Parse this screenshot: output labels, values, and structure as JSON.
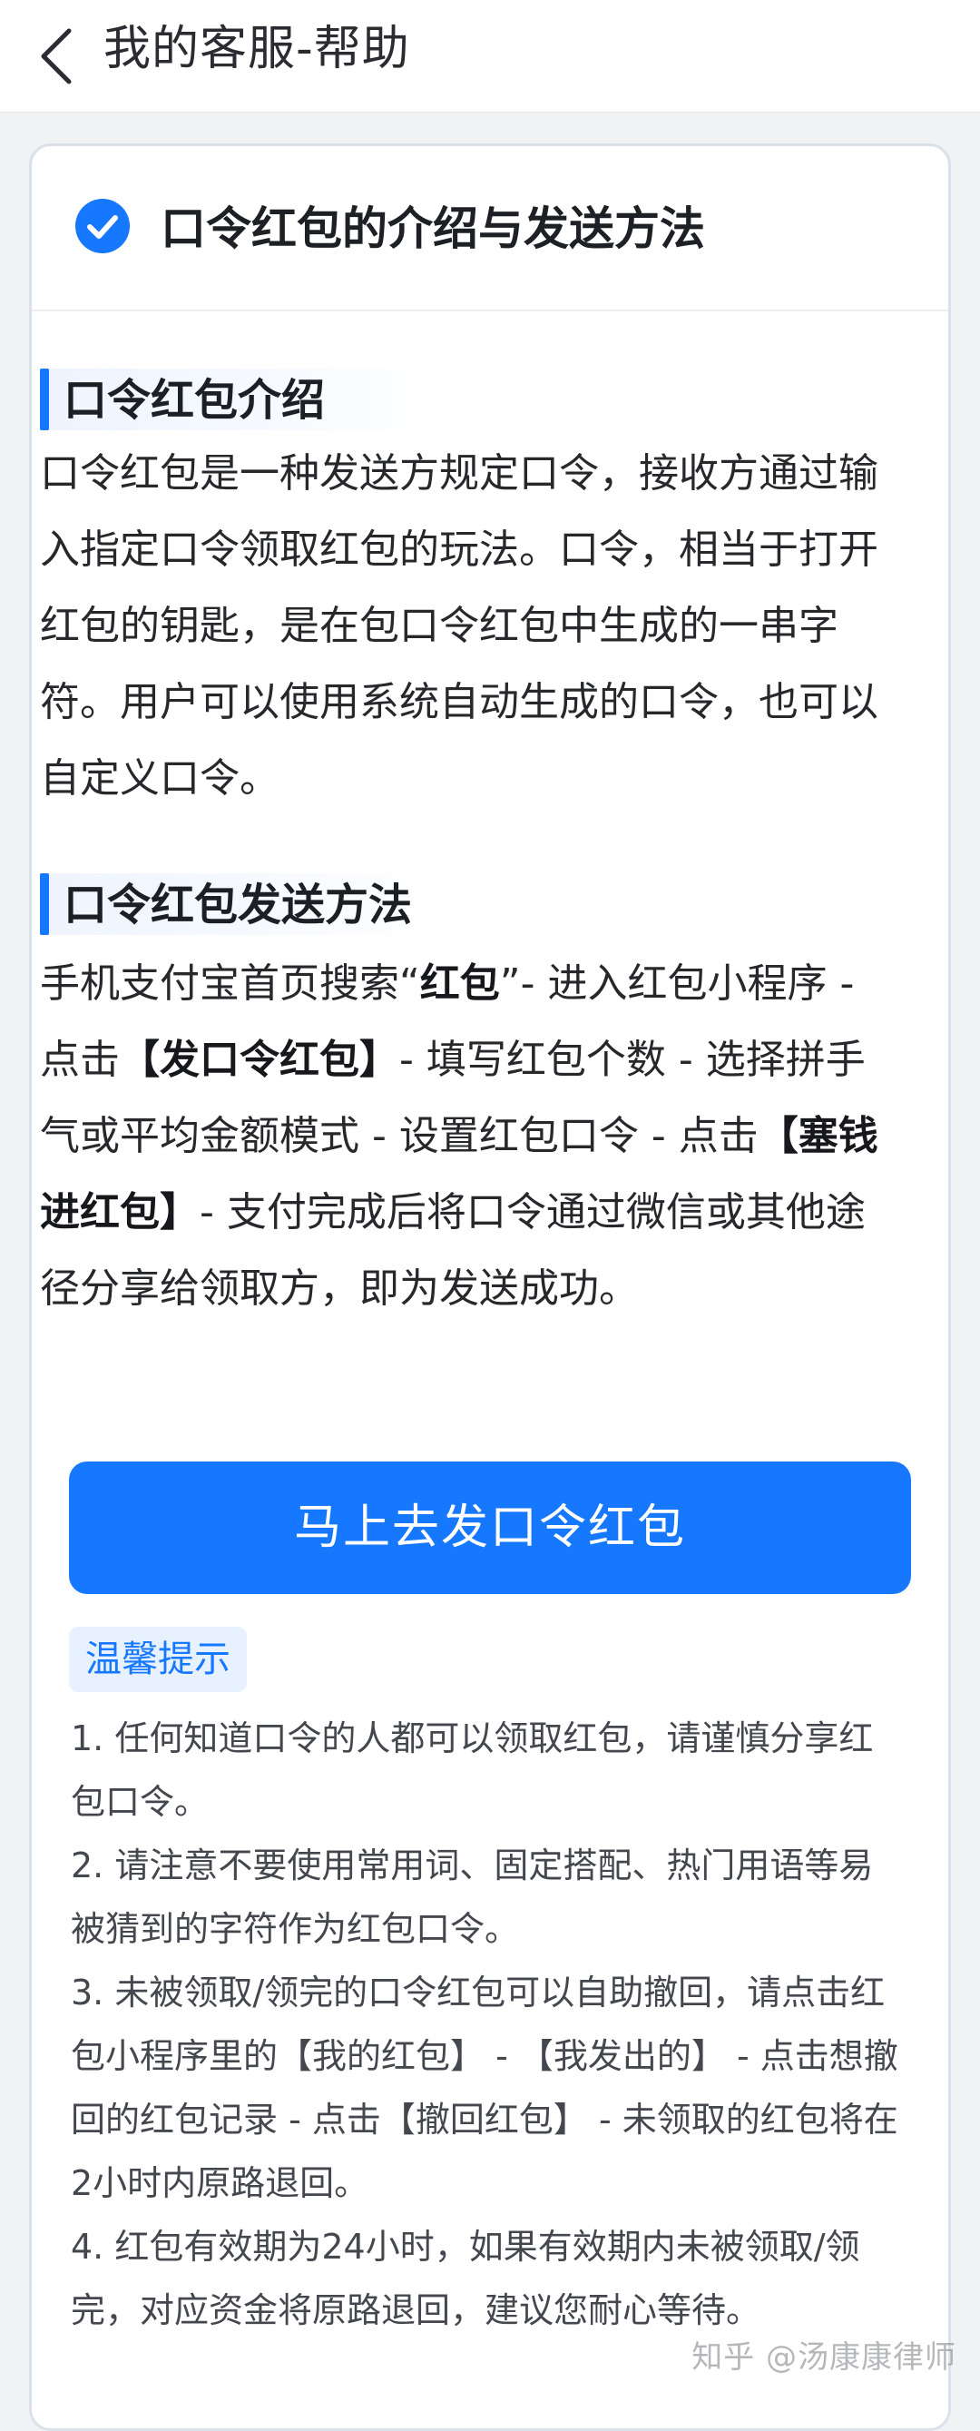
{
  "topbar": {
    "title": "我的客服-帮助"
  },
  "card": {
    "title": "口令红包的介绍与发送方法"
  },
  "section_intro": {
    "heading": "口令红包介绍",
    "paragraph": "口令红包是一种发送方规定口令，接收方通过输入指定口令领取红包的玩法。口令，相当于打开红包的钥匙，是在包口令红包中生成的一串字符。用户可以使用系统自动生成的口令，也可以自定义口令。"
  },
  "section_send": {
    "heading": "口令红包发送方法",
    "p_a": "手机支付宝首页搜索“",
    "p_b": "红包",
    "p_c": "”- 进入红包小程序 - 点击",
    "p_d": "【发口令红包】",
    "p_e": "- 填写红包个数 - 选择拼手气或平均金额模式 - 设置红包口令 - 点击",
    "p_f": "【塞钱进红包】",
    "p_g": "- 支付完成后将口令通过微信或其他途径分享给领取方，即为发送成功。"
  },
  "cta": {
    "label": "马上去发口令红包"
  },
  "tips": {
    "badge": "温馨提示",
    "items": [
      "1. 任何知道口令的人都可以领取红包，请谨慎分享红包口令。",
      "2. 请注意不要使用常用词、固定搭配、热门用语等易被猜到的字符作为红包口令。",
      "3. 未被领取/领完的口令红包可以自助撤回，请点击红包小程序里的【我的红包】 - 【我发出的】 - 点击想撤回的红包记录 - 点击【撤回红包】 - 未领取的红包将在2小时内原路退回。",
      "4. 红包有效期为24小时，如果有效期内未被领取/领完，对应资金将原路退回，建议您耐心等待。"
    ]
  },
  "watermark": "知乎 @汤康康律师",
  "colors": {
    "accent": "#1677ff",
    "background": "#f1f2f4",
    "card": "#ffffff"
  },
  "icons": {
    "back": "chevron-left-icon",
    "title_check": "check-circle-icon"
  }
}
